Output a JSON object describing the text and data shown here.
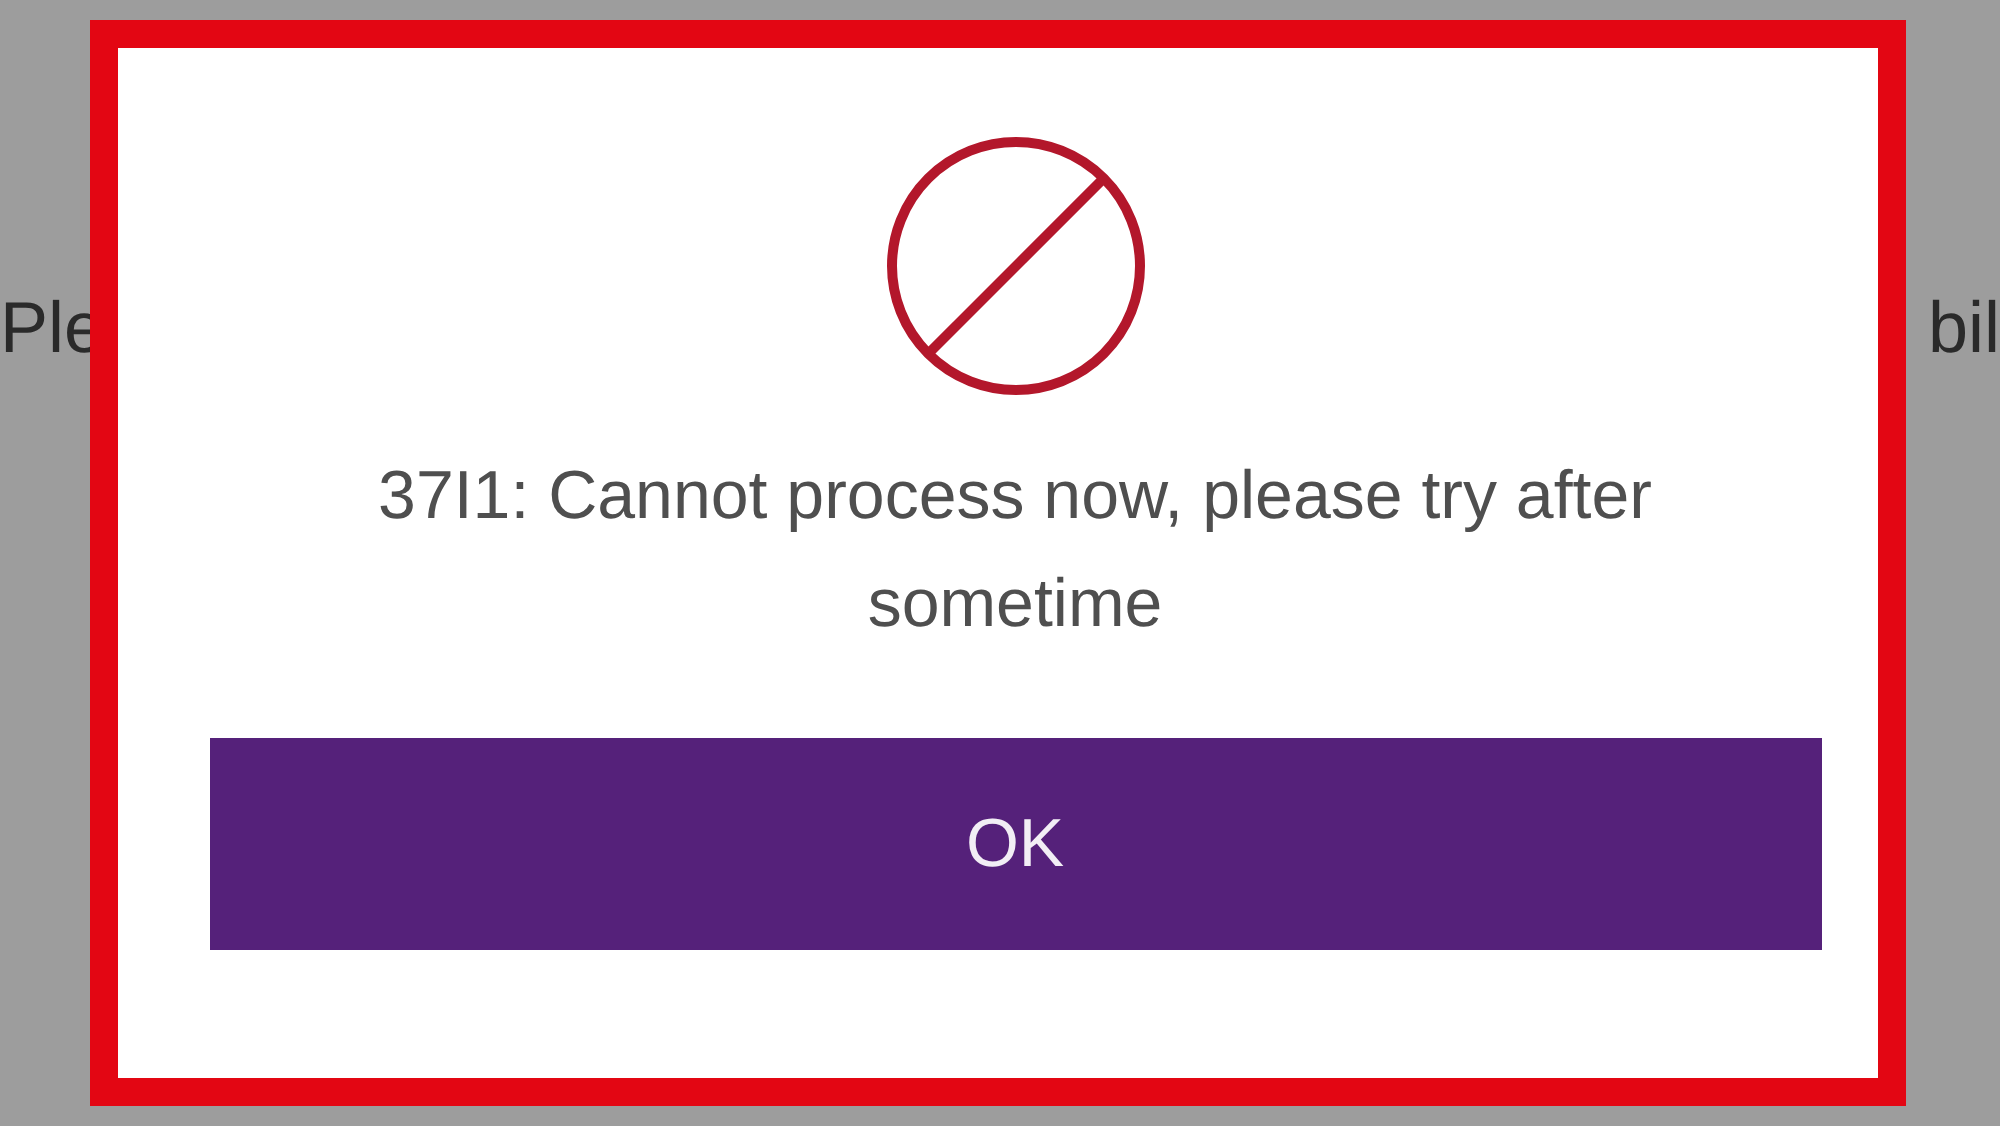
{
  "background": {
    "text_left": "Ple",
    "text_right": "bil"
  },
  "dialog": {
    "message": "37I1: Cannot process now, please try after sometime",
    "button": "OK"
  }
}
